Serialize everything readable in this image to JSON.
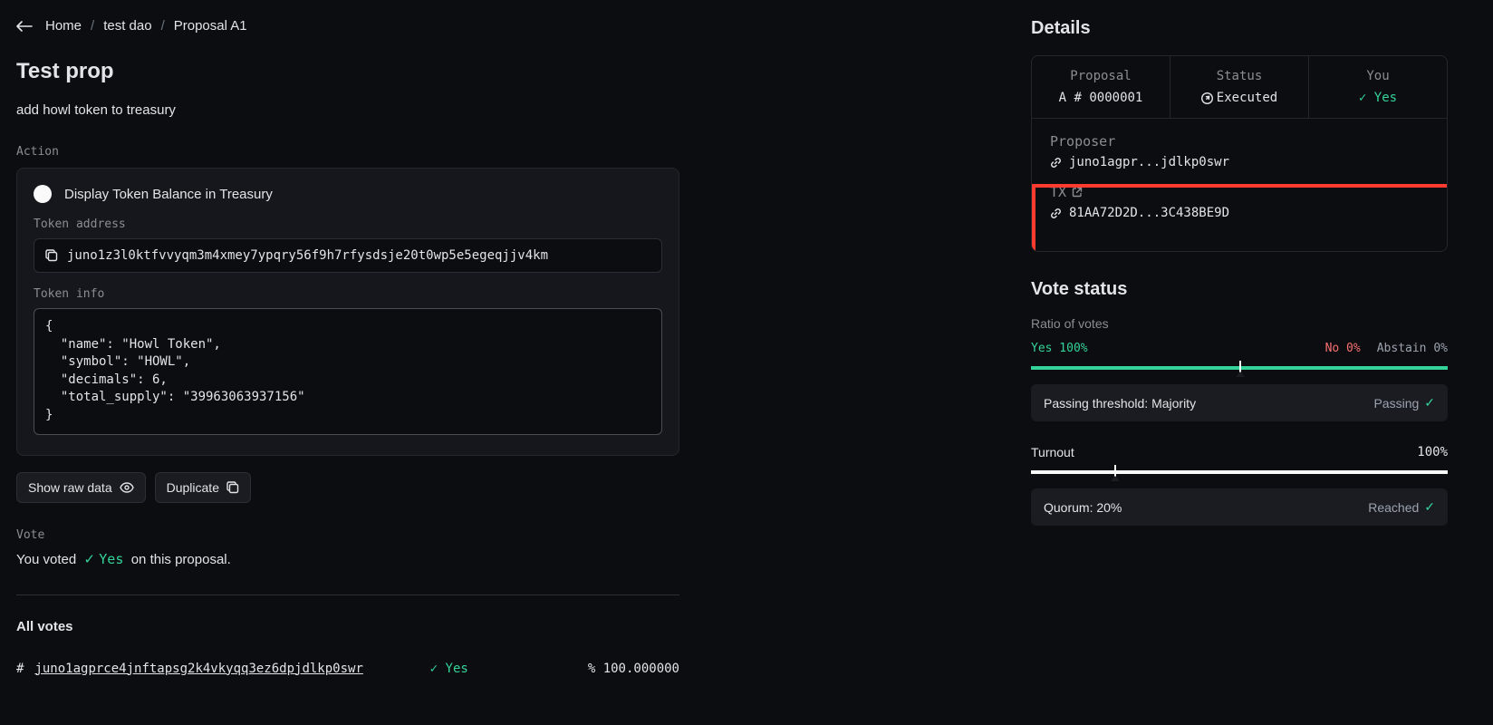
{
  "breadcrumb": {
    "home": "Home",
    "dao": "test dao",
    "proposal": "Proposal A1"
  },
  "page": {
    "title": "Test prop",
    "description": "add howl token to treasury"
  },
  "action": {
    "section_label": "Action",
    "title": "Display Token Balance in Treasury",
    "token_address_label": "Token address",
    "token_address": "juno1z3l0ktfvvyqm3m4xmey7ypqry56f9h7rfysdsje20t0wp5e5egeqjjv4km",
    "token_info_label": "Token info",
    "token_info": "{\n  \"name\": \"Howl Token\",\n  \"symbol\": \"HOWL\",\n  \"decimals\": 6,\n  \"total_supply\": \"39963063937156\"\n}"
  },
  "buttons": {
    "show_raw": "Show raw data",
    "duplicate": "Duplicate"
  },
  "vote": {
    "section_label": "Vote",
    "prefix": "You voted",
    "value": "Yes",
    "suffix": "on this proposal."
  },
  "all_votes": {
    "title": "All votes",
    "row": {
      "hash_prefix": "#",
      "address": "juno1agprce4jnftapsg2k4vkyqq3ez6dpjdlkp0swr",
      "vote": "Yes",
      "pct_prefix": "%",
      "pct": "100.000000"
    }
  },
  "details": {
    "title": "Details",
    "proposal": {
      "label": "Proposal",
      "value": "A # 0000001"
    },
    "status": {
      "label": "Status",
      "value": "Executed"
    },
    "you": {
      "label": "You",
      "value": "Yes"
    },
    "proposer": {
      "label": "Proposer",
      "value": "juno1agpr...jdlkp0swr"
    },
    "tx": {
      "label": "TX",
      "value": "81AA72D2D...3C438BE9D"
    }
  },
  "vote_status": {
    "title": "Vote status",
    "ratio_label": "Ratio of votes",
    "yes": "Yes 100%",
    "no": "No 0%",
    "abstain": "Abstain 0%",
    "threshold_label": "Passing threshold: Majority",
    "threshold_status": "Passing",
    "turnout_label": "Turnout",
    "turnout_pct": "100%",
    "quorum_label": "Quorum: 20%",
    "quorum_status": "Reached"
  }
}
